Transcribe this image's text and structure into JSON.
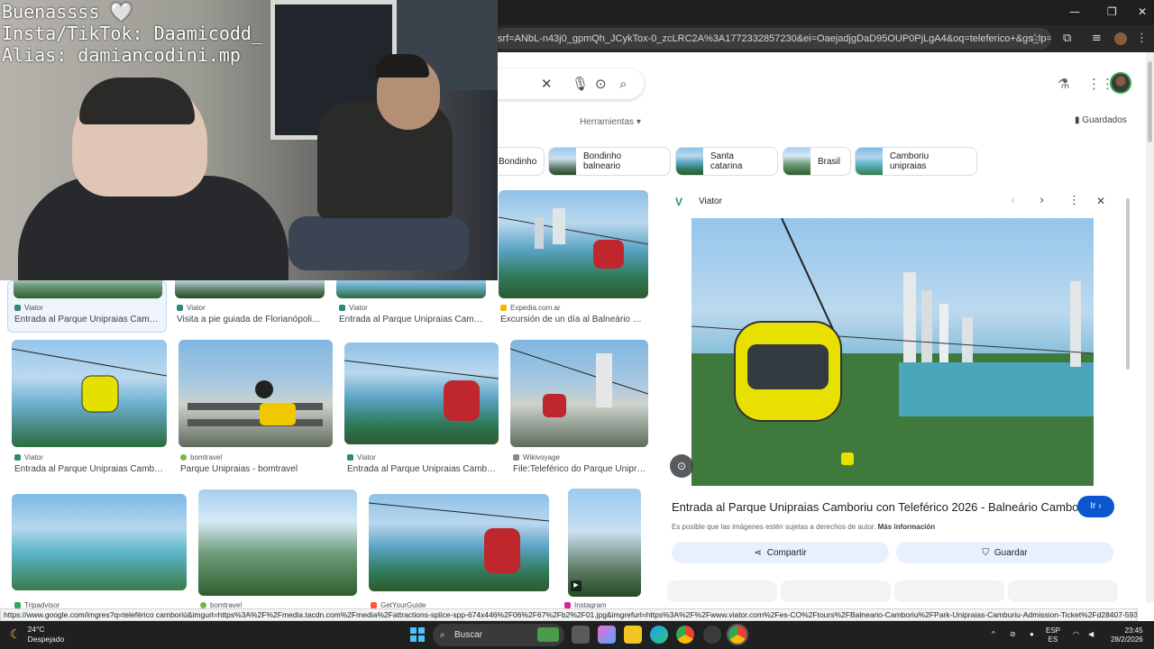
{
  "window": {
    "minimize_glyph": "—",
    "restore_glyph": "❐",
    "close_glyph": "✕"
  },
  "browser": {
    "url_visible": "srf=ANbL-n43j0_gpmQh_JCykTox-0_zcLRC2A%3A1772332857230&ei=OaejadjgDaD95OUP0PjLgA4&oq=teleferico+&gs_lp=Egtnd3Mtd2l6LL...",
    "status_url": "https://www.google.com/imgres?q=teleférico camboriú&imgurl=https%3A%2F%2Fmedia.tacdn.com%2Fmedia%2Fattractions-splice-spp-674x446%2F06%2F67%2Fb2%2F01.jpg&imgrefurl=https%3A%2F%2Fwww.viator.com%2Fes-CO%2Ftours%2FBalneario-Camboriu%2FPark-Unipraias-Camburiu-Admission-Ticket%2Fd28407-59300P1&docid=CEP1QFq..."
  },
  "google": {
    "tools_label": "Herramientas",
    "saved_label": "Guardados",
    "chips": [
      {
        "label": "Bondinho"
      },
      {
        "label": "Bondinho balneario"
      },
      {
        "label": "Santa catarina"
      },
      {
        "label": "Brasil"
      },
      {
        "label": "Camboriu unipraias"
      }
    ],
    "results_row1": [
      {
        "source": "Viator",
        "title": "Entrada al Parque Unipraias Camb..."
      },
      {
        "source": "Viator",
        "title": "Visita a pie guiada de Florianópolis..."
      },
      {
        "source": "Viator",
        "title": "Entrada al Parque Unipraias Camb..."
      },
      {
        "source": "Expedia.com.ar",
        "title": "Excursión de un día al Balneário C..."
      }
    ],
    "results_row2": [
      {
        "source": "Viator",
        "title": "Entrada al Parque Unipraias Cambo..."
      },
      {
        "source": "bomtravel",
        "title": "Parque Unipraias - bomtravel"
      },
      {
        "source": "Viator",
        "title": "Entrada al Parque Unipraias Cambo..."
      },
      {
        "source": "Wikivoyage",
        "title": "File:Teleférico do Parque Unipra..."
      }
    ],
    "results_row3": [
      {
        "source": "Tripadvisor"
      },
      {
        "source": "bomtravel"
      },
      {
        "source": "GetYourGuide"
      },
      {
        "source": "Instagram"
      }
    ]
  },
  "panel": {
    "source": "Viator",
    "title": "Entrada al Parque Unipraias Camboriu con Teleférico 2026 - Balneário Camboriú",
    "go_label": "Ir",
    "note": "Es posible que las imágenes estén sujetas a derechos de autor.",
    "more_info": "Más información",
    "share_label": "Compartir",
    "save_label": "Guardar"
  },
  "overlay": {
    "line1": "Buenassss 🤍",
    "line2": "Insta/TikTok: Daamicodd_",
    "line3": "Alias: damiancodini.mp"
  },
  "taskbar": {
    "temp": "24°C",
    "weather": "Despejado",
    "search_label": "Buscar",
    "lang_top": "ESP",
    "lang_bottom": "ES",
    "time": "23:45",
    "date": "28/2/2026"
  },
  "colors": {
    "accent": "#0b57d0",
    "taskbar": "#202020",
    "chrome_dark": "#1f1f1f"
  }
}
